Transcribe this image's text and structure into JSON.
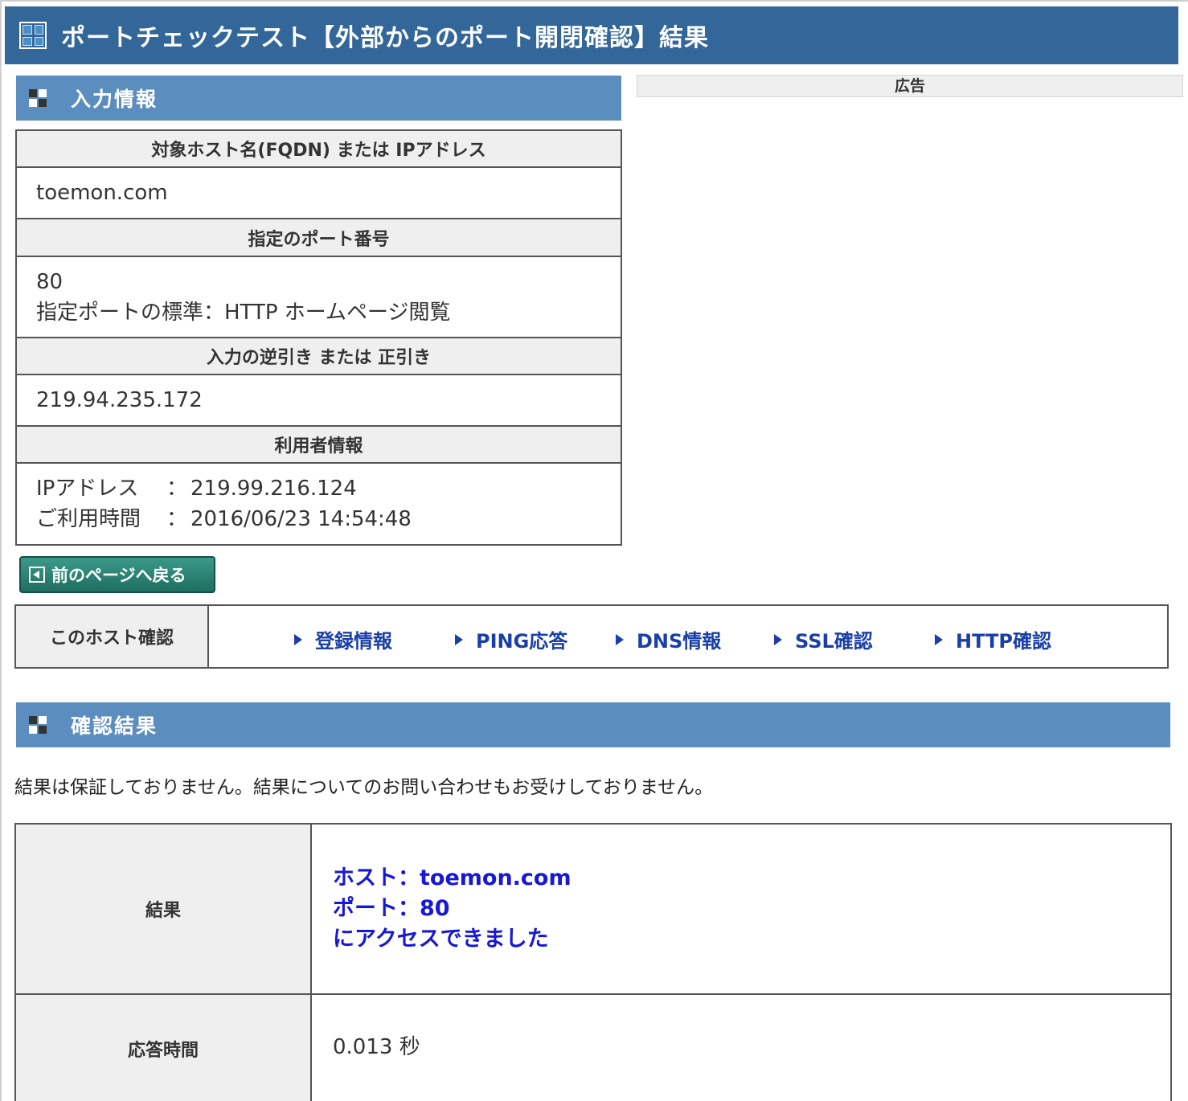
{
  "page": {
    "title": "ポートチェックテスト【外部からのポート開閉確認】結果",
    "ad_label": "広告"
  },
  "input_section": {
    "heading": "入力情報",
    "rows": [
      {
        "label": "対象ホスト名(FQDN) または IPアドレス",
        "lines": [
          "toemon.com"
        ]
      },
      {
        "label": "指定のポート番号",
        "lines": [
          "80",
          "指定ポートの標準：HTTP ホームページ閲覧"
        ]
      },
      {
        "label": "入力の逆引き または 正引き",
        "lines": [
          "219.94.235.172"
        ]
      }
    ],
    "user_info": {
      "label": "利用者情報",
      "ip_key": "IPアドレス",
      "ip_value": "219.99.216.124",
      "time_key": "ご利用時間",
      "time_value": "2016/06/23 14:54:48",
      "separator": "："
    }
  },
  "back_button": {
    "label": "前のページへ戻る"
  },
  "host_nav": {
    "label": "このホスト確認",
    "links": [
      "登録情報",
      "PING応答",
      "DNS情報",
      "SSL確認",
      "HTTP確認"
    ]
  },
  "result_section": {
    "heading": "確認結果",
    "disclaimer": "結果は保証しておりません。結果についてのお問い合わせもお受けしておりません。",
    "result_label": "結果",
    "result_lines": [
      "ホスト：toemon.com",
      "ポート：80",
      "にアクセスできました"
    ],
    "response_label": "応答時間",
    "response_value": "0.013 秒"
  },
  "colors": {
    "title_bar": "#336699",
    "section_header": "#5b8dbf",
    "link": "#1a3fa8",
    "result_text": "#1717d6",
    "back_button": "#2a8374"
  }
}
